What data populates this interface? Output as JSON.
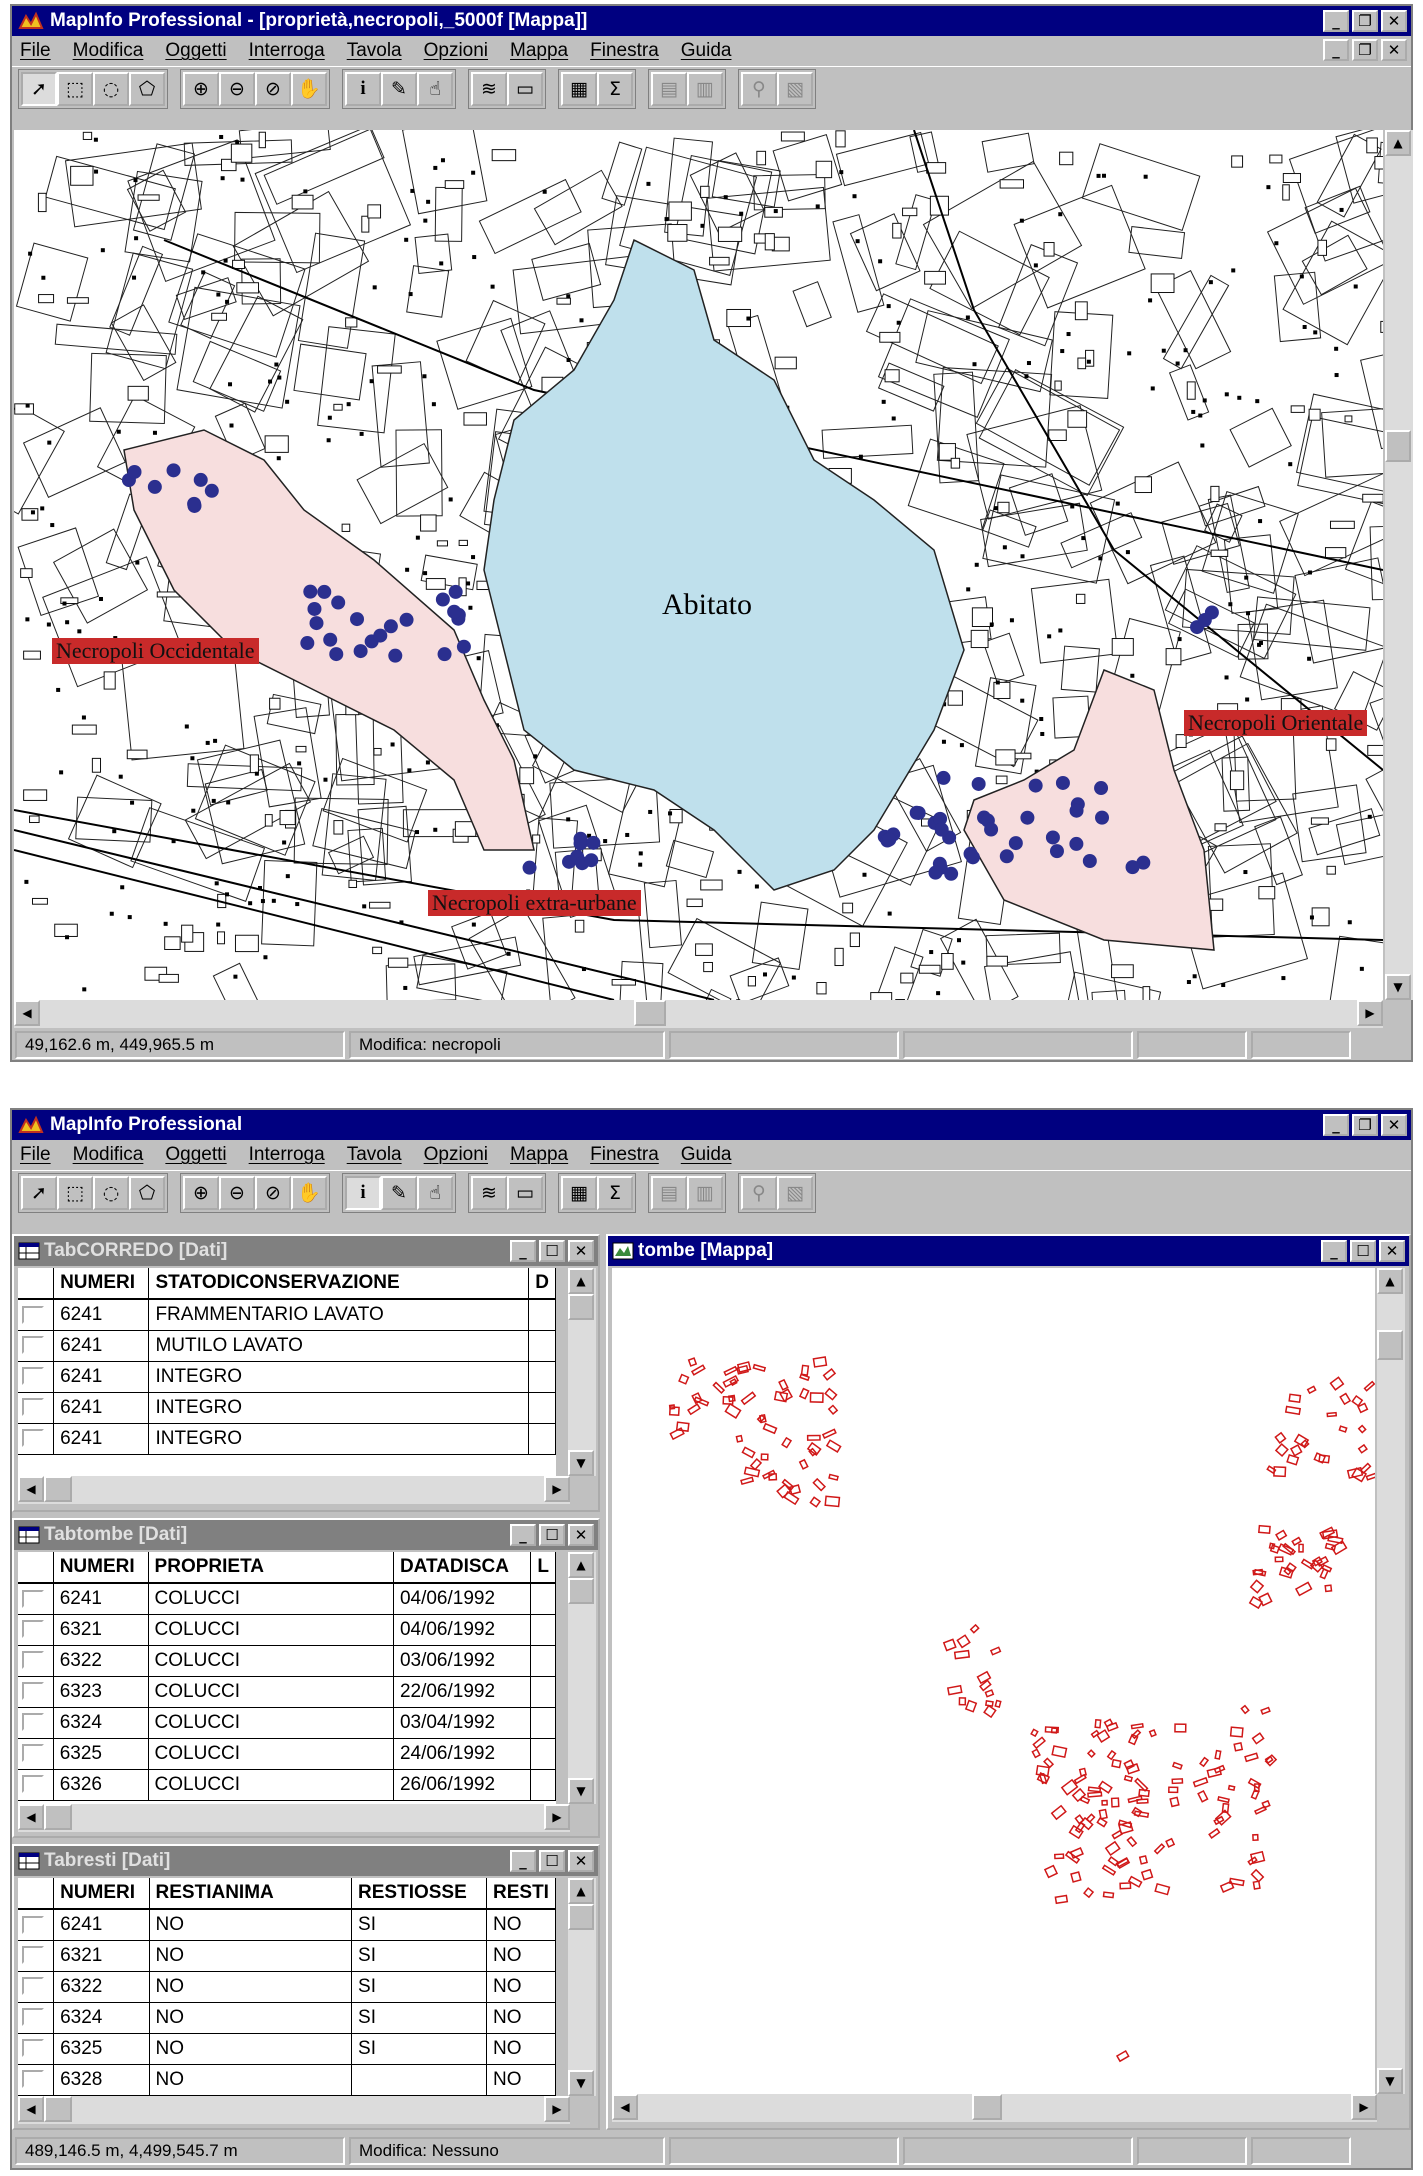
{
  "app": {
    "name": "MapInfo Professional"
  },
  "window1": {
    "title": "MapInfo Professional - [proprietà,necropoli,_5000f [Mappa]]",
    "menu": [
      "File",
      "Modifica",
      "Oggetti",
      "Interroga",
      "Tavola",
      "Opzioni",
      "Mappa",
      "Finestra",
      "Guida"
    ],
    "map": {
      "center_label": "Abitato",
      "labels": {
        "occidentale": "Necropoli Occidentale",
        "orientale": "Necropoli Orientale",
        "extra": "Necropoli extra-urbane"
      }
    },
    "status": {
      "coords": "49,162.6 m, 449,965.5 m",
      "edit": "Modifica: necropoli"
    }
  },
  "window2": {
    "title": "MapInfo Professional",
    "menu": [
      "File",
      "Modifica",
      "Oggetti",
      "Interroga",
      "Tavola",
      "Opzioni",
      "Mappa",
      "Finestra",
      "Guida"
    ],
    "corredo": {
      "title": "TabCORREDO [Dati]",
      "headers": [
        "NUMERI",
        "STATODICONSERVAZIONE",
        "D"
      ],
      "rows": [
        [
          "6241",
          "FRAMMENTARIO LAVATO"
        ],
        [
          "6241",
          "MUTILO LAVATO"
        ],
        [
          "6241",
          "INTEGRO"
        ],
        [
          "6241",
          "INTEGRO"
        ],
        [
          "6241",
          "INTEGRO"
        ]
      ]
    },
    "tombe": {
      "title": "Tabtombe [Dati]",
      "headers": [
        "NUMERI",
        "PROPRIETA",
        "DATADISCA",
        "L"
      ],
      "rows": [
        [
          "6241",
          "COLUCCI",
          "04/06/1992"
        ],
        [
          "6321",
          "COLUCCI",
          "04/06/1992"
        ],
        [
          "6322",
          "COLUCCI",
          "03/06/1992"
        ],
        [
          "6323",
          "COLUCCI",
          "22/06/1992"
        ],
        [
          "6324",
          "COLUCCI",
          "03/04/1992"
        ],
        [
          "6325",
          "COLUCCI",
          "24/06/1992"
        ],
        [
          "6326",
          "COLUCCI",
          "26/06/1992"
        ]
      ]
    },
    "resti": {
      "title": "Tabresti [Dati]",
      "headers": [
        "NUMERI",
        "RESTIANIMA",
        "RESTIOSSE",
        "RESTI"
      ],
      "rows": [
        [
          "6241",
          "NO",
          "SI",
          "NO"
        ],
        [
          "6321",
          "NO",
          "SI",
          "NO"
        ],
        [
          "6322",
          "NO",
          "SI",
          "NO"
        ],
        [
          "6324",
          "NO",
          "SI",
          "NO"
        ],
        [
          "6325",
          "NO",
          "SI",
          "NO"
        ],
        [
          "6328",
          "NO",
          "",
          "NO"
        ]
      ]
    },
    "mapwin": {
      "title": "tombe [Mappa]"
    },
    "status": {
      "coords": "489,146.5 m, 4,499,545.7 m",
      "edit": "Modifica: Nessuno"
    }
  },
  "colors": {
    "title_active": "#000080",
    "title_inactive": "#808080",
    "lake": "#bfe0ec",
    "necropoli_area": "#f7dede",
    "points": "#2b2f8f",
    "tomb_outline": "#d01818",
    "label_bg": "#c82a2a"
  }
}
